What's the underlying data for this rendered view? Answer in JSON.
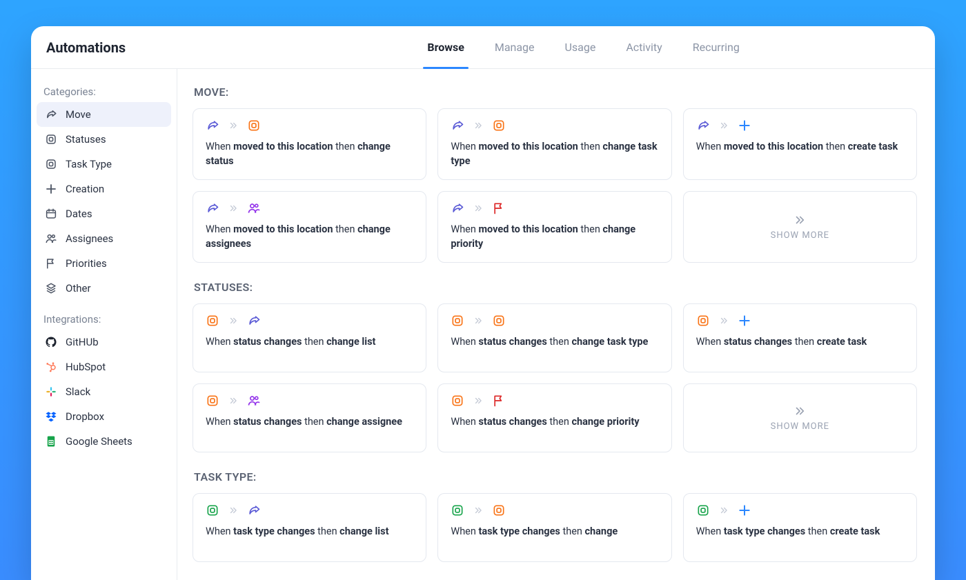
{
  "header": {
    "title": "Automations",
    "tabs": [
      "Browse",
      "Manage",
      "Usage",
      "Activity",
      "Recurring"
    ],
    "active_tab": 0
  },
  "sidebar": {
    "heading_categories": "Categories:",
    "categories": [
      {
        "icon": "move",
        "label": "Move",
        "active": true
      },
      {
        "icon": "status",
        "label": "Statuses",
        "active": false
      },
      {
        "icon": "status",
        "label": "Task Type",
        "active": false
      },
      {
        "icon": "plus",
        "label": "Creation",
        "active": false
      },
      {
        "icon": "calendar",
        "label": "Dates",
        "active": false
      },
      {
        "icon": "assignees",
        "label": "Assignees",
        "active": false
      },
      {
        "icon": "flag",
        "label": "Priorities",
        "active": false
      },
      {
        "icon": "other",
        "label": "Other",
        "active": false
      }
    ],
    "heading_integrations": "Integrations:",
    "integrations": [
      {
        "icon": "github",
        "label": "GitHUb"
      },
      {
        "icon": "hubspot",
        "label": "HubSpot"
      },
      {
        "icon": "slack",
        "label": "Slack"
      },
      {
        "icon": "dropbox",
        "label": "Dropbox"
      },
      {
        "icon": "gsheets",
        "label": "Google Sheets"
      }
    ]
  },
  "sections": [
    {
      "title": "MOVE:",
      "cards": [
        {
          "from_icon": "move-purple",
          "to_icon": "status-orange",
          "text_prefix": "When ",
          "text_bold1": "moved to this location",
          "text_mid": " then ",
          "text_bold2": "change status"
        },
        {
          "from_icon": "move-purple",
          "to_icon": "status-orange",
          "text_prefix": "When ",
          "text_bold1": "moved to this location",
          "text_mid": " then ",
          "text_bold2": "change task type"
        },
        {
          "from_icon": "move-purple",
          "to_icon": "plus-blue",
          "text_prefix": "When ",
          "text_bold1": "moved to this location",
          "text_mid": " then ",
          "text_bold2": "create task"
        },
        {
          "from_icon": "move-purple",
          "to_icon": "assignees-purple",
          "text_prefix": "When ",
          "text_bold1": "moved to this location",
          "text_mid": " then ",
          "text_bold2": "change assignees"
        },
        {
          "from_icon": "move-purple",
          "to_icon": "flag-red",
          "text_prefix": "When ",
          "text_bold1": "moved to this location",
          "text_mid": " then ",
          "text_bold2": "change priority"
        }
      ],
      "show_more": "SHOW MORE"
    },
    {
      "title": "STATUSES:",
      "cards": [
        {
          "from_icon": "status-orange",
          "to_icon": "move-purple",
          "text_prefix": "When ",
          "text_bold1": "status changes",
          "text_mid": " then ",
          "text_bold2": "change list"
        },
        {
          "from_icon": "status-orange",
          "to_icon": "status-orange",
          "text_prefix": "When ",
          "text_bold1": "status changes",
          "text_mid": " then ",
          "text_bold2": "change task type"
        },
        {
          "from_icon": "status-orange",
          "to_icon": "plus-blue",
          "text_prefix": "When ",
          "text_bold1": "status changes",
          "text_mid": " then ",
          "text_bold2": "create task"
        },
        {
          "from_icon": "status-orange",
          "to_icon": "assignees-purple",
          "text_prefix": "When ",
          "text_bold1": "status changes",
          "text_mid": " then ",
          "text_bold2": "change assignee"
        },
        {
          "from_icon": "status-orange",
          "to_icon": "flag-red",
          "text_prefix": "When ",
          "text_bold1": "status changes",
          "text_mid": " then ",
          "text_bold2": "change priority"
        }
      ],
      "show_more": "SHOW MORE"
    },
    {
      "title": "TASK TYPE:",
      "cards": [
        {
          "from_icon": "status-green",
          "to_icon": "move-purple",
          "text_prefix": "When ",
          "text_bold1": "task type changes",
          "text_mid": " then ",
          "text_bold2": "change list"
        },
        {
          "from_icon": "status-green",
          "to_icon": "status-orange",
          "text_prefix": "When ",
          "text_bold1": "task type changes",
          "text_mid": " then ",
          "text_bold2": "change"
        },
        {
          "from_icon": "status-green",
          "to_icon": "plus-blue",
          "text_prefix": "When ",
          "text_bold1": "task type changes",
          "text_mid": " then ",
          "text_bold2": "create task"
        }
      ],
      "show_more": null
    }
  ]
}
